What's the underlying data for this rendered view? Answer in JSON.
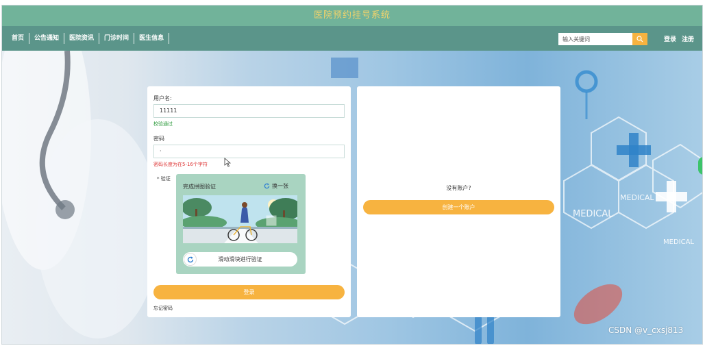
{
  "header": {
    "site_title": "医院预约挂号系统",
    "nav_items": [
      "首页",
      "公告通知",
      "医院资讯",
      "门诊时间",
      "医生信息"
    ],
    "search_placeholder": "输入关键词",
    "login_link": "登录",
    "register_link": "注册"
  },
  "login_form": {
    "username_label": "用户名:",
    "username_value": "11111",
    "username_status": "校验通过",
    "password_label": "密码",
    "password_value": "·",
    "password_error": "密码长度为在5-16个字符",
    "verify_label": "* 验证",
    "captcha": {
      "title": "完成拼图验证",
      "refresh_label": "换一张",
      "slider_hint": "滑动滑块进行验证"
    },
    "submit_label": "登录",
    "forgot_link": "忘记密码"
  },
  "register_panel": {
    "prompt": "没有账户?",
    "create_button": "创建一个账户"
  },
  "watermark": "CSDN @v_cxsj813",
  "colors": {
    "title_bar": "#71b39a",
    "nav_bar": "#5b958a",
    "accent_orange": "#f7b340",
    "title_text": "#f2d36b",
    "ok_green": "#2c9a3c",
    "error_red": "#dd3333"
  }
}
